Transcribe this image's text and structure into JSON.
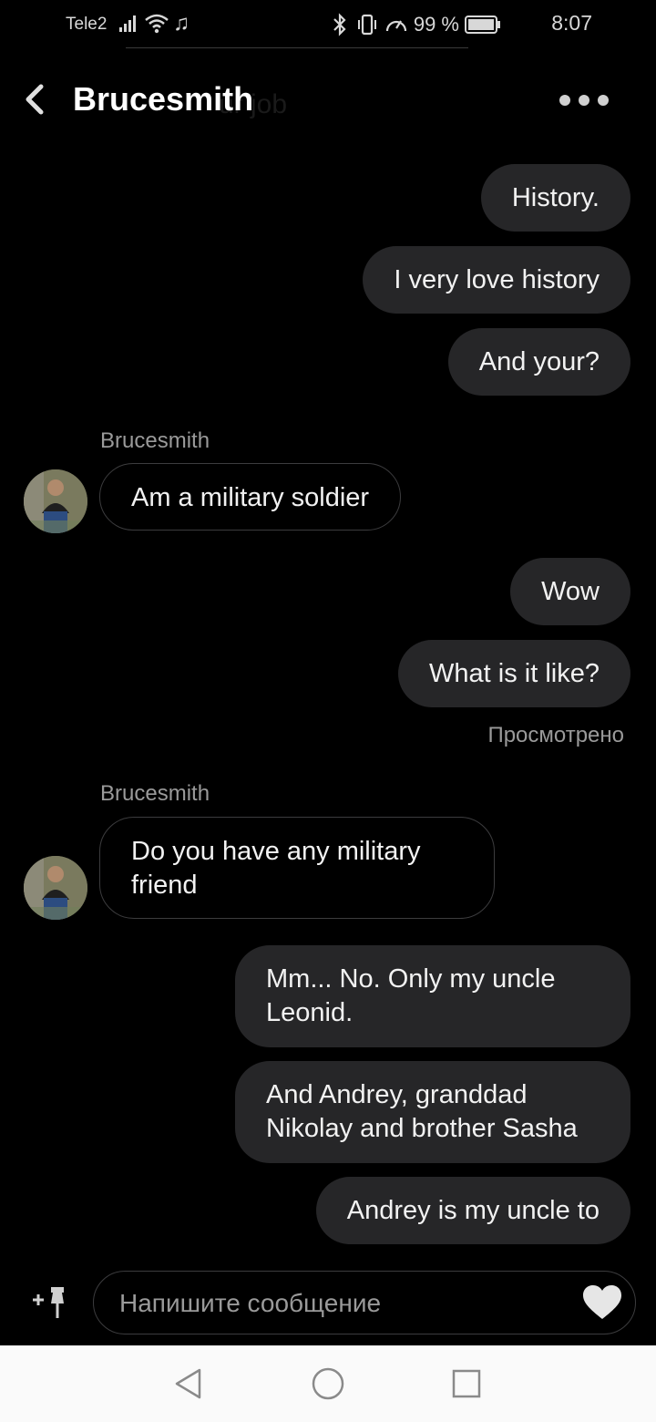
{
  "status_bar": {
    "carrier": "Tele2",
    "battery_percent": "99 %",
    "time": "8:07"
  },
  "header": {
    "title": "Brucesmith",
    "ghost_text": "ur job",
    "back_icon": "chevron-left-icon",
    "more_icon": "more-horizontal-icon"
  },
  "messages": [
    {
      "direction": "out",
      "text": "History."
    },
    {
      "direction": "out",
      "text": "I very love history"
    },
    {
      "direction": "out",
      "text": "And your?"
    },
    {
      "direction": "in",
      "sender": "Brucesmith",
      "text": "Am a military soldier"
    },
    {
      "direction": "out",
      "text": "Wow"
    },
    {
      "direction": "out",
      "text": "What is it like?"
    },
    {
      "direction": "in",
      "sender": "Brucesmith",
      "text": "Do you have any military friend"
    },
    {
      "direction": "out",
      "text": "Mm... No. Only my uncle Leonid."
    },
    {
      "direction": "out",
      "text": "And Andrey, granddad Nikolay and brother Sasha"
    },
    {
      "direction": "out",
      "text": "Andrey is my uncle to"
    }
  ],
  "seen_label": "Просмотрено",
  "composer": {
    "placeholder": "Напишите сообщение",
    "attach_icon": "add-pin-icon",
    "like_icon": "heart-icon"
  },
  "nav_bar": {
    "back_icon": "triangle-back-icon",
    "home_icon": "circle-home-icon",
    "recents_icon": "square-recents-icon"
  },
  "colors": {
    "background": "#000000",
    "outgoing_bubble": "#262628",
    "incoming_border": "#3c3c3e",
    "secondary_text": "#9a9a9a"
  }
}
